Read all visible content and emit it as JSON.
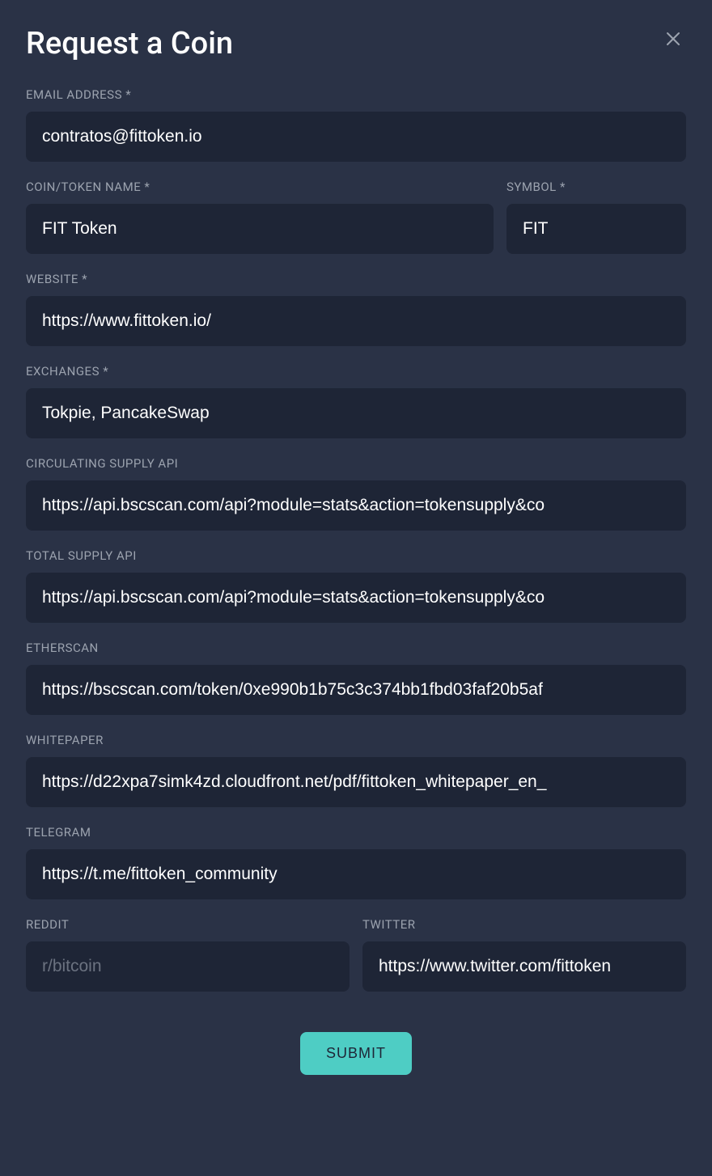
{
  "title": "Request a Coin",
  "fields": {
    "email": {
      "label": "EMAIL ADDRESS *",
      "value": "contratos@fittoken.io"
    },
    "coinName": {
      "label": "COIN/TOKEN NAME *",
      "value": "FIT Token"
    },
    "symbol": {
      "label": "SYMBOL *",
      "value": "FIT"
    },
    "website": {
      "label": "WEBSITE *",
      "value": "https://www.fittoken.io/"
    },
    "exchanges": {
      "label": "EXCHANGES *",
      "value": "Tokpie, PancakeSwap"
    },
    "circulatingSupply": {
      "label": "CIRCULATING SUPPLY API",
      "value": "https://api.bscscan.com/api?module=stats&action=tokensupply&co"
    },
    "totalSupply": {
      "label": "TOTAL SUPPLY API",
      "value": "https://api.bscscan.com/api?module=stats&action=tokensupply&co"
    },
    "etherscan": {
      "label": "ETHERSCAN",
      "value": "https://bscscan.com/token/0xe990b1b75c3c374bb1fbd03faf20b5af"
    },
    "whitepaper": {
      "label": "WHITEPAPER",
      "value": "https://d22xpa7simk4zd.cloudfront.net/pdf/fittoken_whitepaper_en_"
    },
    "telegram": {
      "label": "TELEGRAM",
      "value": "https://t.me/fittoken_community"
    },
    "reddit": {
      "label": "REDDIT",
      "value": "",
      "placeholder": "r/bitcoin"
    },
    "twitter": {
      "label": "TWITTER",
      "value": "https://www.twitter.com/fittoken"
    }
  },
  "submitLabel": "SUBMIT"
}
